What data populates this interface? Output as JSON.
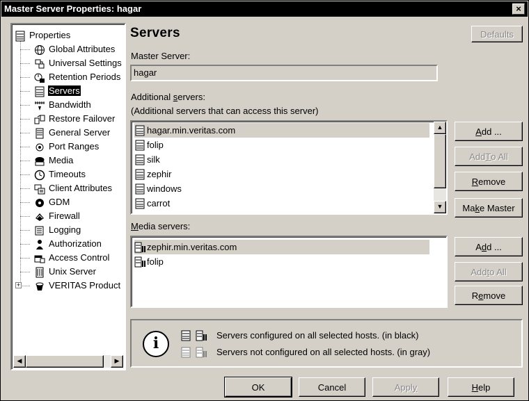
{
  "window": {
    "title": "Master Server Properties: hagar",
    "close_glyph": "×"
  },
  "tree": {
    "items": [
      {
        "label": "Properties",
        "icon": "server-icon"
      },
      {
        "label": "Global Attributes",
        "icon": "globe-icon"
      },
      {
        "label": "Universal Settings",
        "icon": "universal-settings-icon"
      },
      {
        "label": "Retention Periods",
        "icon": "retention-icon"
      },
      {
        "label": "Servers",
        "icon": "server-icon"
      },
      {
        "label": "Bandwidth",
        "icon": "bandwidth-icon"
      },
      {
        "label": "Restore Failover",
        "icon": "restore-failover-icon"
      },
      {
        "label": "General Server",
        "icon": "general-server-icon"
      },
      {
        "label": "Port Ranges",
        "icon": "port-ranges-icon"
      },
      {
        "label": "Media",
        "icon": "media-icon"
      },
      {
        "label": "Timeouts",
        "icon": "clock-icon"
      },
      {
        "label": "Client Attributes",
        "icon": "client-attributes-icon"
      },
      {
        "label": "GDM",
        "icon": "gdm-icon"
      },
      {
        "label": "Firewall",
        "icon": "firewall-icon"
      },
      {
        "label": "Logging",
        "icon": "logging-icon"
      },
      {
        "label": "Authorization",
        "icon": "authorization-icon"
      },
      {
        "label": "Access Control",
        "icon": "access-control-icon"
      },
      {
        "label": "Unix Server",
        "icon": "unix-server-icon"
      },
      {
        "label": "VERITAS Product",
        "icon": "veritas-icon"
      }
    ],
    "selected": "Servers",
    "expander_glyph": "+"
  },
  "page": {
    "heading": "Servers",
    "defaults_button": "Defaults"
  },
  "master_server": {
    "label": "Master Server:",
    "value": "hagar"
  },
  "additional_servers": {
    "label_pre": "Additional ",
    "label_mnemonic": "s",
    "label_post": "ervers:",
    "sublabel": "(Additional servers that can access this server)",
    "items": [
      "hagar.min.veritas.com",
      "folip",
      "silk",
      "zephir",
      "windows",
      "carrot"
    ],
    "buttons": {
      "add": {
        "pre": "",
        "mn": "A",
        "post": "dd ..."
      },
      "add_to_all": {
        "pre": "Add ",
        "mn": "T",
        "post": "o All"
      },
      "remove": {
        "pre": "",
        "mn": "R",
        "post": "emove"
      },
      "make_master": {
        "pre": "Ma",
        "mn": "k",
        "post": "e Master"
      }
    }
  },
  "media_servers": {
    "label_pre": "",
    "label_mnemonic": "M",
    "label_post": "edia servers:",
    "items": [
      "zephir.min.veritas.com",
      "folip"
    ],
    "buttons": {
      "add": {
        "pre": "A",
        "mn": "d",
        "post": "d ..."
      },
      "add_to_all": {
        "pre": "Add ",
        "mn": "t",
        "post": "o All"
      },
      "remove": {
        "pre": "R",
        "mn": "e",
        "post": "move"
      }
    }
  },
  "legend": {
    "info_glyph": "i",
    "configured": "Servers configured on all selected hosts. (in black)",
    "not_configured": "Servers not configured on all selected hosts. (in gray)"
  },
  "footer": {
    "ok": "OK",
    "cancel": "Cancel",
    "apply": {
      "pre": "Appl",
      "mn": "y",
      "post": ""
    },
    "help": {
      "pre": "",
      "mn": "H",
      "post": "elp"
    }
  },
  "scroll_glyphs": {
    "left": "◀",
    "right": "▶",
    "up": "▲",
    "down": "▼"
  }
}
